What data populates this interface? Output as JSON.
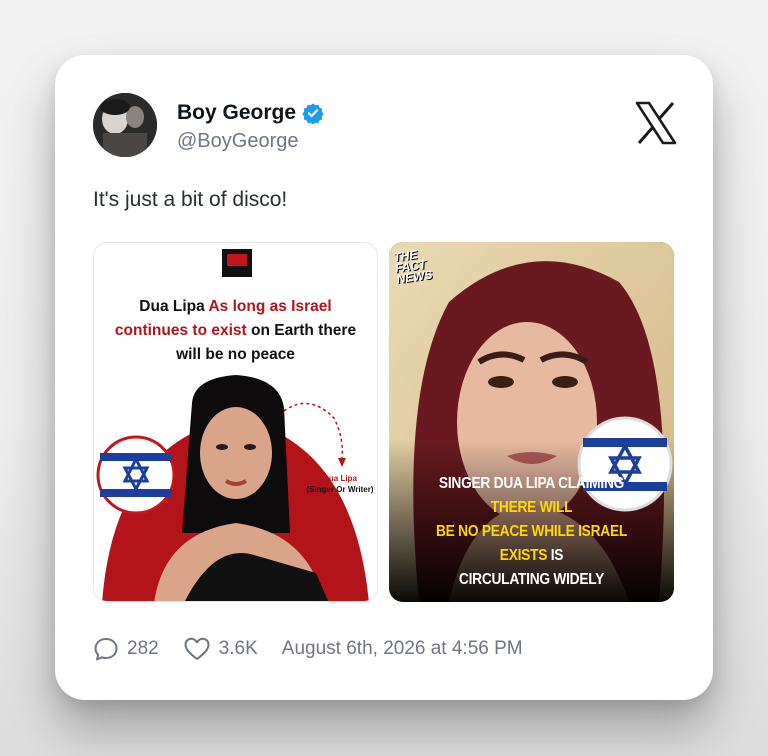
{
  "tweet": {
    "display_name": "Boy George",
    "handle": "@BoyGeorge",
    "text": "It's just a bit of disco!",
    "replies": "282",
    "likes": "3.6K",
    "date": "August 6th, 2026 at 4:56 PM"
  },
  "media_left": {
    "headline_part1": "Dua Lipa ",
    "headline_red1": "As long as Israel",
    "headline_red2": "continues to exist",
    "headline_part2": " on Earth there",
    "headline_part3": "will be no peace",
    "arrow_label_name": "Dua Lipa",
    "arrow_label_role": "(Singer Or Writer)"
  },
  "media_right": {
    "watermark": [
      "THE",
      "FACT",
      "NEWS"
    ],
    "caption_white1": "SINGER DUA LIPA CLAIMING ",
    "caption_yellow1": "THERE WILL",
    "caption_yellow2": "BE NO PEACE WHILE ISRAEL EXISTS",
    "caption_white2": " IS",
    "caption_white3": "CIRCULATING WIDELY"
  },
  "colors": {
    "verified": "#1d9bf0",
    "headline_red": "#b3141a",
    "caption_yellow": "#ffd800",
    "israel_blue": "#1c3f9e"
  },
  "icons": [
    "verified-badge-icon",
    "x-logo-icon",
    "reply-icon",
    "heart-icon",
    "star-of-david-icon"
  ]
}
